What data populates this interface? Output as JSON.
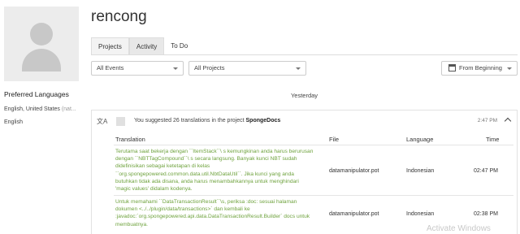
{
  "profile": {
    "username": "rencong",
    "preferred_languages_title": "Preferred Languages",
    "languages": [
      {
        "name": "English, United States",
        "note": "(nat..."
      },
      {
        "name": "English",
        "note": ""
      }
    ]
  },
  "tabs": [
    {
      "label": "Projects"
    },
    {
      "label": "Activity",
      "active": true
    },
    {
      "label": "To Do"
    }
  ],
  "filters": {
    "events": "All Events",
    "projects": "All Projects",
    "order": "From Beginning"
  },
  "day_label": "Yesterday",
  "activity": {
    "summary_prefix": "You suggested 26 translations in the project",
    "project": "SpongeDocs",
    "time": "2:47 PM",
    "columns": {
      "translation": "Translation",
      "file": "File",
      "language": "Language",
      "time": "Time"
    },
    "rows": [
      {
        "translation": "Terutama saat bekerja dengan ``ItemStack``\\ s kemungkinan anda harus berurusan dengan ``NBTTagCompound``\\ s secara langsung. Banyak kunci NBT sudah didefinisikan sebagai ketetapan di kelas ``org.spongepowered.common.data.util.NbtDataUtil``. Jika kunci yang anda butuhkan tidak ada disana, anda harus menambahkannya untuk menghindari 'magic values' didalam kodenya.",
        "file": "datamanipulator.pot",
        "language": "Indonesian",
        "time": "02:47 PM"
      },
      {
        "translation": "Untuk memahami ``DataTransactionResult``\\s, periksa :doc: sesuai halaman dokumen <../../plugin/data/transactions>` dan kembali ke :javadoc:`org.spongepowered.api.data.DataTransactionResult.Builder` docs untuk membuatnya.",
        "file": "datamanipulator.pot",
        "language": "Indonesian",
        "time": "02:38 PM"
      }
    ]
  },
  "watermark": "Activate Windows"
}
